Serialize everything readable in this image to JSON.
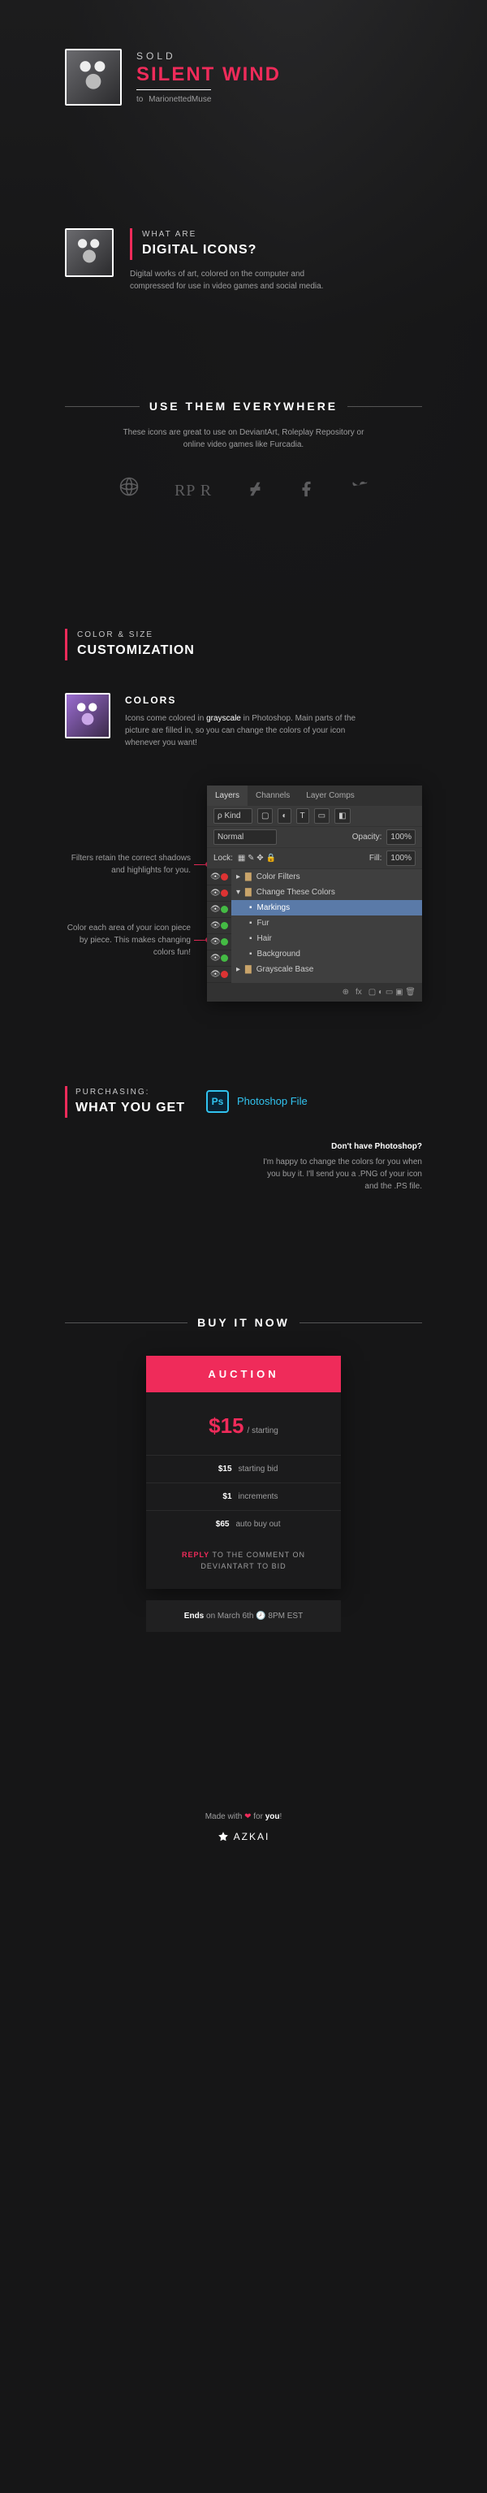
{
  "header": {
    "sold": "SOLD",
    "title": "SILENT WIND",
    "to": "to",
    "buyer": "MarionettedMuse"
  },
  "what": {
    "kicker": "WHAT ARE",
    "title": "DIGITAL ICONS?",
    "desc": "Digital works of art, colored on the computer and compressed for use in video games and social media."
  },
  "use": {
    "title": "USE THEM EVERYWHERE",
    "desc": "These icons are great to use on DeviantArt, Roleplay Repository or online video games like Furcadia.",
    "logos": {
      "rpr": "RP   R"
    }
  },
  "custom": {
    "kicker": "COLOR & SIZE",
    "title": "CUSTOMIZATION",
    "colors_h": "COLORS",
    "colors_p1": "Icons come colored in ",
    "colors_em": "grayscale",
    "colors_p2": " in Photoshop. Main parts of the picture are filled in, so you can change the colors of your icon whenever you want!",
    "annot1": "Filters retain the correct shadows and highlights for you.",
    "annot2": "Color each area of your icon piece by piece. This makes changing colors fun!",
    "ps": {
      "tabs": [
        "Layers",
        "Channels",
        "Layer Comps"
      ],
      "kind": "Kind",
      "blend": "Normal",
      "opacity_l": "Opacity:",
      "opacity_v": "100%",
      "lock": "Lock:",
      "fill_l": "Fill:",
      "fill_v": "100%",
      "layers": [
        {
          "name": "Color Filters",
          "dot": "red",
          "folder": true
        },
        {
          "name": "Change These Colors",
          "dot": "red",
          "folder": true,
          "open": true
        },
        {
          "name": "Markings",
          "dot": "green",
          "sel": true,
          "indent": 2
        },
        {
          "name": "Fur",
          "dot": "green",
          "indent": 2
        },
        {
          "name": "Hair",
          "dot": "green",
          "indent": 2
        },
        {
          "name": "Background",
          "dot": "green",
          "indent": 2
        },
        {
          "name": "Grayscale Base",
          "dot": "red",
          "folder": true
        }
      ],
      "foot": "fx"
    }
  },
  "purch": {
    "kicker": "PURCHASING:",
    "title": "WHAT YOU GET",
    "file": "Photoshop File",
    "nop_h": "Don't have Photoshop?",
    "nop_p": "I'm happy to change the colors for you when you buy it. I'll send you a .PNG of your icon and the .PS file."
  },
  "buy": {
    "title": "BUY IT NOW",
    "card_hd": "AUCTION",
    "price": "$15",
    "price_sub": "/ starting",
    "lines": [
      {
        "amt": "$15",
        "lbl": "starting bid"
      },
      {
        "amt": "$1",
        "lbl": "increments"
      },
      {
        "amt": "$65",
        "lbl": "auto buy out"
      }
    ],
    "reply1": "REPLY",
    "reply2": " TO THE COMMENT ON DEVIANTART TO BID",
    "ends_pre": "Ends",
    "ends_on": " on March 6th ",
    "ends_at": " 8PM EST"
  },
  "foot": {
    "made1": "Made with ",
    "made2": " for ",
    "you": "you",
    "brand": "AZKAI"
  }
}
